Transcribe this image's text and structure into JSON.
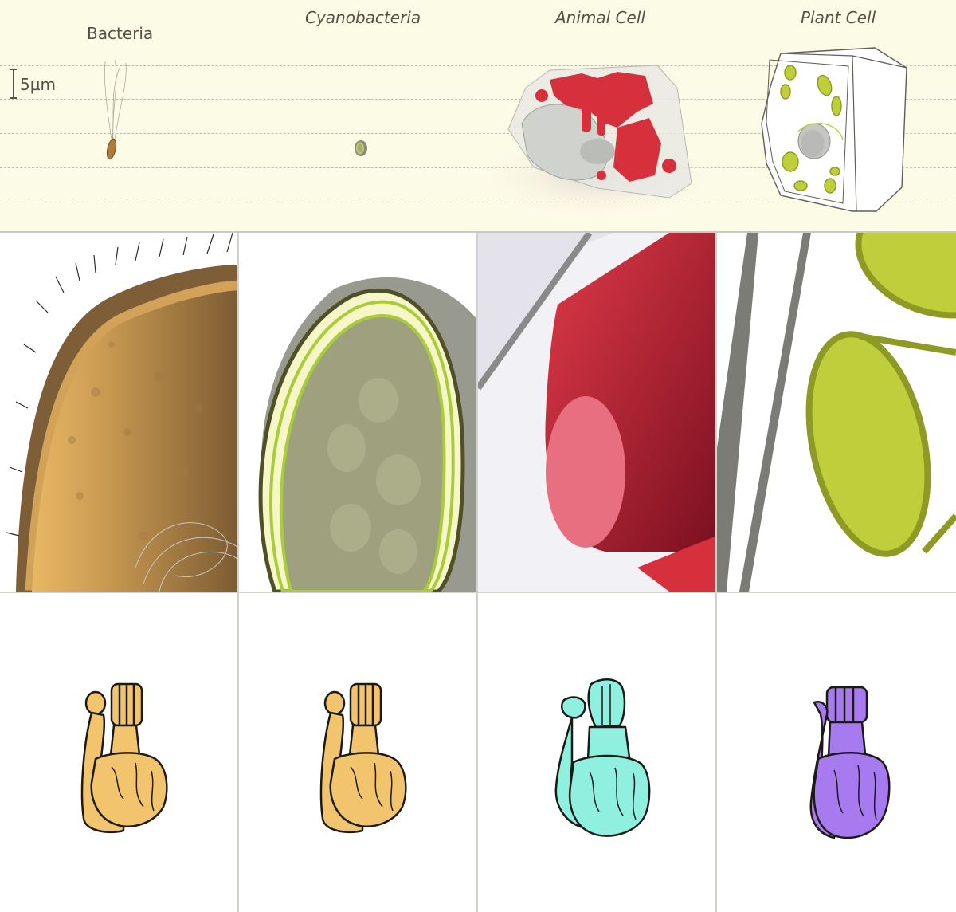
{
  "labels": {
    "bacteria": "Bacteria",
    "cyanobacteria": "Cyanobacteria",
    "animal_cell": "Animal Cell",
    "plant_cell": "Plant Cell"
  },
  "scale": {
    "text": "5µm"
  },
  "colors": {
    "background_panel": "#fcfbe6",
    "bacteria_brown": "#b78a4a",
    "cyano_green": "#9fc23a",
    "animal_red": "#d7303d",
    "plant_green": "#bfcf3b",
    "atp_synthase_bacteria": "#f2c46e",
    "atp_synthase_cyano": "#f2c46e",
    "atp_synthase_animal": "#8ff0e0",
    "atp_synthase_plant": "#a77af0"
  },
  "icons": {
    "row3": [
      "atp-synthase-bacteria",
      "atp-synthase-cyanobacteria",
      "atp-synthase-animal",
      "atp-synthase-plant"
    ]
  }
}
